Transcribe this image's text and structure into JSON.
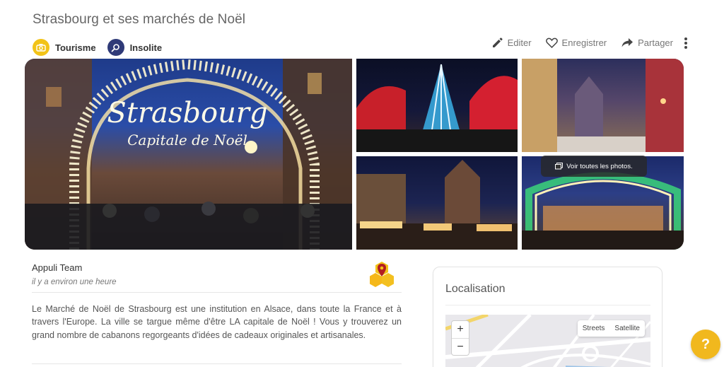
{
  "page": {
    "title": "Strasbourg et ses marchés de Noël"
  },
  "tags": [
    {
      "label": "Tourisme",
      "icon": "camera-icon",
      "color": "#f2c318"
    },
    {
      "label": "Insolite",
      "icon": "magnifier-icon",
      "color": "#2f3a78"
    }
  ],
  "actions": {
    "edit": "Editer",
    "save": "Enregistrer",
    "share": "Partager"
  },
  "gallery": {
    "main_sign_line1": "Strasbourg",
    "main_sign_line2": "Capitale de Noël",
    "see_all": "Voir toutes les photos."
  },
  "post": {
    "author": "Appuli Team",
    "time": "il y a environ une heure",
    "description": "Le Marché de Noël de Strasbourg est une institution en Alsace, dans toute la France et à travers l'Europe. La ville se targue même d'être LA capitale de Noël ! Vous y trouverez un grand nombre de cabanons regorgeants d'idées de cadeaux originales et artisanales."
  },
  "location": {
    "title": "Localisation",
    "zoom_in": "+",
    "zoom_out": "−",
    "layer_streets": "Streets",
    "layer_satellite": "Satellite"
  },
  "help": {
    "label": "?"
  },
  "colors": {
    "accent": "#f1b81e",
    "brand_dark": "#2f3a78"
  }
}
